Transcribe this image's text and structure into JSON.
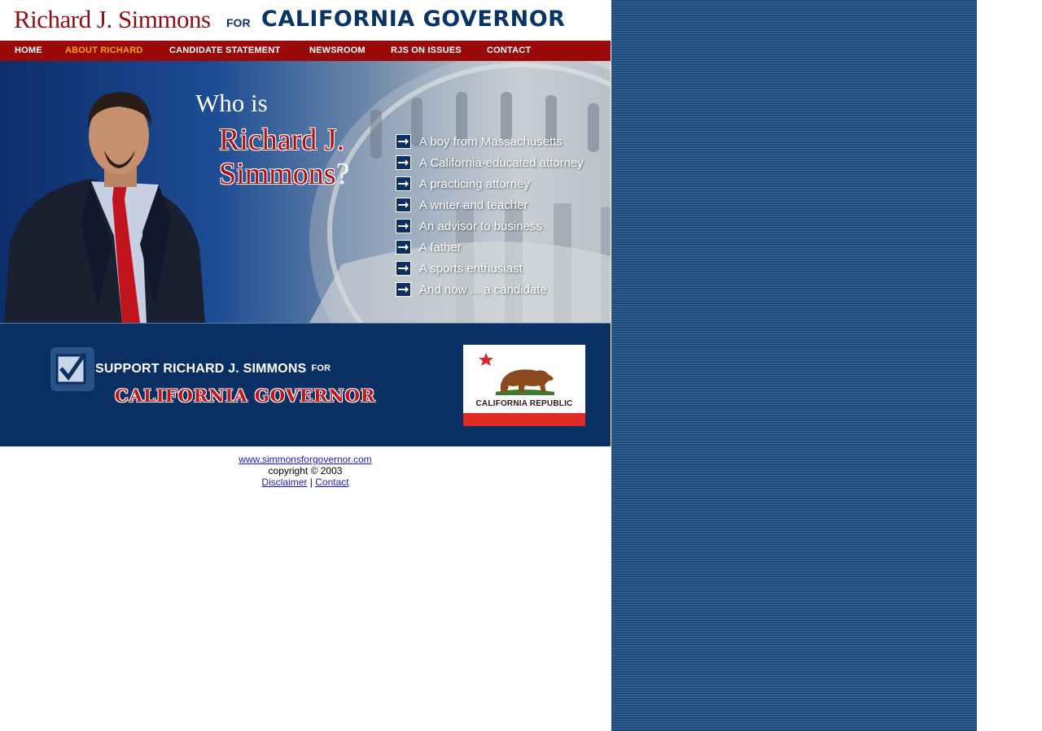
{
  "header": {
    "name": "Richard J. Simmons",
    "for": "FOR",
    "office": "CALIFORNIA GOVERNOR"
  },
  "nav": {
    "items": [
      {
        "label": "HOME"
      },
      {
        "label": "ABOUT RICHARD"
      },
      {
        "label": "CANDIDATE STATEMENT"
      },
      {
        "label": "NEWSROOM"
      },
      {
        "label": "RJS ON ISSUES"
      },
      {
        "label": "CONTACT"
      }
    ],
    "active": "ABOUT RICHARD"
  },
  "hero": {
    "who_is": "Who is",
    "name_line1": "Richard J.",
    "name_line2": "Simmons",
    "question_mark": "?",
    "bullets": [
      "A boy from Massachusetts",
      "A California-educated attorney",
      "A practicing attorney",
      "A writer and teacher",
      "An advisor to business",
      "A father",
      "A sports enthusiast",
      "And now ... a candidate"
    ]
  },
  "support": {
    "line1": "SUPPORT RICHARD J. SIMMONS",
    "line1_for": "FOR",
    "line2": "CALIFORNIA GOVERNOR",
    "flag_text": "CALIFORNIA REPUBLIC"
  },
  "footer": {
    "site_link": "www.simmonsforgovernor.com",
    "copyright": "copyright © 2003",
    "disclaimer": "Disclaimer",
    "separator": "|",
    "contact": "Contact"
  },
  "colors": {
    "header_red": "#8e0d12",
    "navy": "#0a3466",
    "nav_bar": "#9b0a0a",
    "nav_active": "#f4a11c",
    "support_bg": "#0a2f63",
    "side_panel": "#1d4a7a"
  },
  "icons": [
    "arrow-right-icon",
    "checkbox-check-icon",
    "california-bear-flag-icon",
    "star-icon"
  ]
}
